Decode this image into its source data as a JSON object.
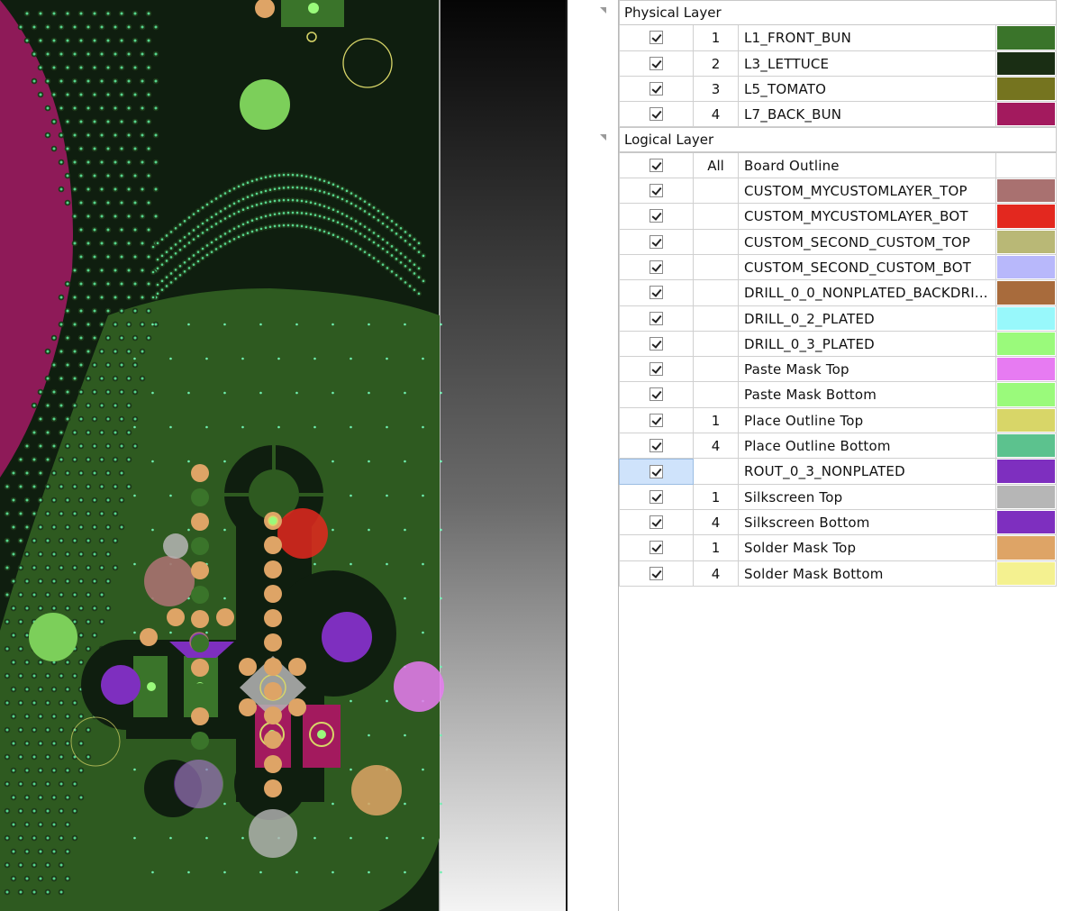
{
  "colors": {
    "board_dark": "#0f1e0f",
    "board_green": "#2e5a20",
    "magenta": "#8e1a58"
  },
  "physical": {
    "title": "Physical Layer",
    "rows": [
      {
        "num": "1",
        "name": "L1_FRONT_BUN",
        "color": "#3a742a"
      },
      {
        "num": "2",
        "name": "L3_LETTUCE",
        "color": "#1a2e14"
      },
      {
        "num": "3",
        "name": "L5_TOMATO",
        "color": "#75741f"
      },
      {
        "num": "4",
        "name": "L7_BACK_BUN",
        "color": "#a31a5e"
      }
    ]
  },
  "logical": {
    "title": "Logical Layer",
    "rows": [
      {
        "num": "All",
        "name": "Board Outline",
        "color": "#ffffff"
      },
      {
        "num": "",
        "name": "CUSTOM_MYCUSTOMLAYER_TOP",
        "color": "#a97170"
      },
      {
        "num": "",
        "name": "CUSTOM_MYCUSTOMLAYER_BOT",
        "color": "#e3281f"
      },
      {
        "num": "",
        "name": "CUSTOM_SECOND_CUSTOM_TOP",
        "color": "#b9b876"
      },
      {
        "num": "",
        "name": "CUSTOM_SECOND_CUSTOM_BOT",
        "color": "#b8b8fb"
      },
      {
        "num": "",
        "name": "DRILL_0_0_NONPLATED_BACKDRI...",
        "color": "#a86b3c"
      },
      {
        "num": "",
        "name": "DRILL_0_2_PLATED",
        "color": "#98f8fb"
      },
      {
        "num": "",
        "name": "DRILL_0_3_PLATED",
        "color": "#9afa7b"
      },
      {
        "num": "",
        "name": "Paste Mask Top",
        "color": "#e77bf2"
      },
      {
        "num": "",
        "name": "Paste Mask Bottom",
        "color": "#9afa7b"
      },
      {
        "num": "1",
        "name": "Place Outline Top",
        "color": "#d8d668"
      },
      {
        "num": "4",
        "name": "Place Outline Bottom",
        "color": "#5cc28e"
      },
      {
        "num": "",
        "name": "ROUT_0_3_NONPLATED",
        "color": "#7e2fbf"
      },
      {
        "num": "1",
        "name": "Silkscreen Top",
        "color": "#b6b6b6"
      },
      {
        "num": "4",
        "name": "Silkscreen Bottom",
        "color": "#7e2fbf"
      },
      {
        "num": "1",
        "name": "Solder Mask Top",
        "color": "#dea466"
      },
      {
        "num": "4",
        "name": "Solder Mask Bottom",
        "color": "#f4f190"
      }
    ]
  }
}
